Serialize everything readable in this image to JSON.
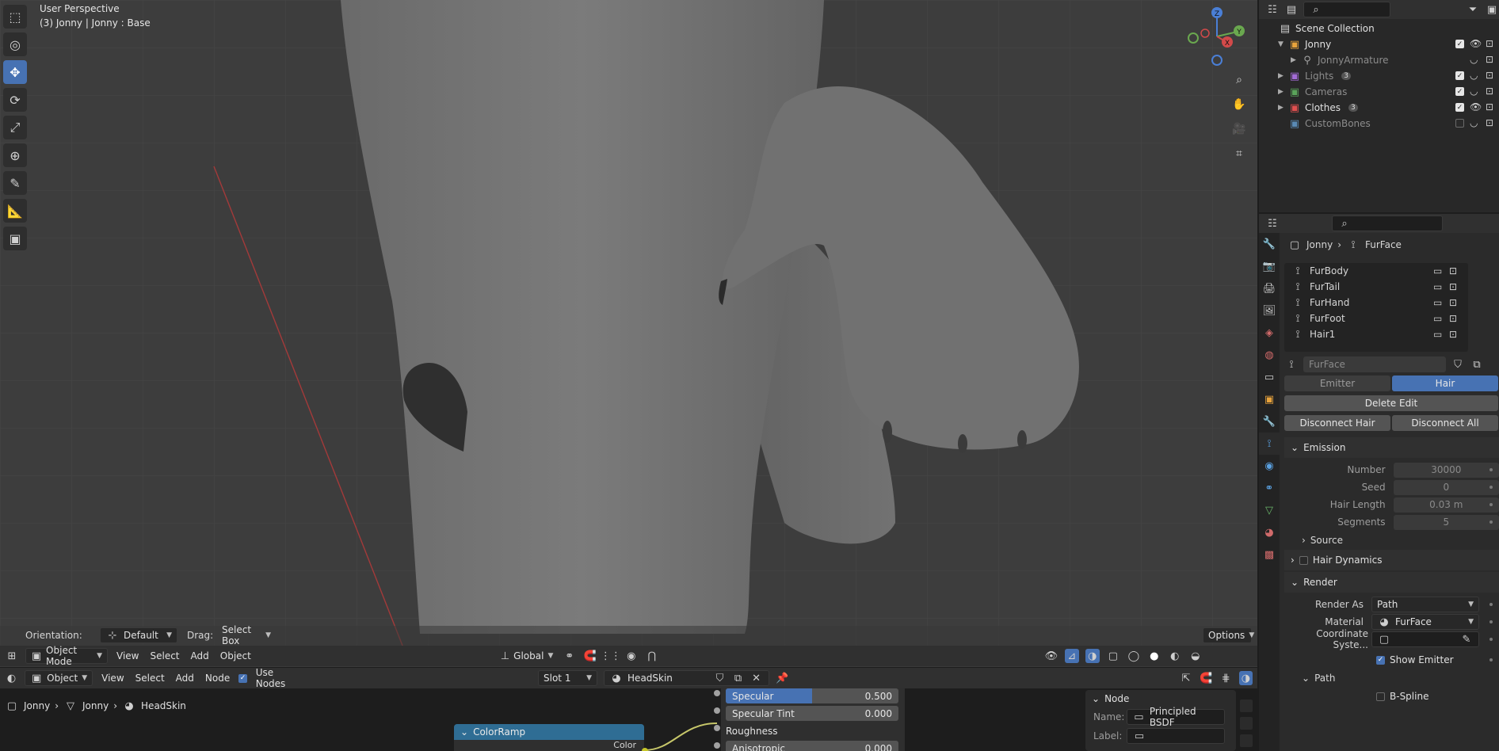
{
  "viewport": {
    "title": "User Perspective",
    "subtitle": "(3) Jonny | Jonny : Base",
    "orientation_label": "Orientation:",
    "orientation_value": "Default",
    "drag_label": "Drag:",
    "drag_value": "Select Box",
    "options_label": "Options",
    "gizmo": {
      "z": "Z",
      "y": "Y",
      "x": "X"
    },
    "header": {
      "mode": "Object Mode",
      "menus": [
        "View",
        "Select",
        "Add",
        "Object"
      ],
      "transform": "Global"
    }
  },
  "node_editor": {
    "header": {
      "type": "Object",
      "menus": [
        "View",
        "Select",
        "Add",
        "Node"
      ],
      "use_nodes_label": "Use Nodes",
      "slot": "Slot 1",
      "material": "HeadSkin"
    },
    "breadcrumb": [
      "Jonny",
      "Jonny",
      "HeadSkin"
    ],
    "colorramp_title": "ColorRamp",
    "colorramp_output": "Color",
    "bsdf_rows": [
      {
        "label": "Specular",
        "value": "0.500",
        "fill": 0.5
      },
      {
        "label": "Specular Tint",
        "value": "0.000",
        "fill": 0
      },
      {
        "label": "Roughness",
        "value": "",
        "fill": 0
      },
      {
        "label": "Anisotropic",
        "value": "0.000",
        "fill": 0
      }
    ],
    "sidebar": {
      "section": "Node",
      "name_label": "Name:",
      "name_value": "Principled BSDF",
      "label_label": "Label:",
      "label_value": ""
    }
  },
  "outliner": {
    "root": "Scene Collection",
    "items": [
      {
        "name": "Jonny",
        "color": "#e8a33c",
        "indent": 1,
        "expanded": true,
        "checked": true,
        "dim": false
      },
      {
        "name": "JonnyArmature",
        "color": "#a0a0a0",
        "indent": 2,
        "expanded": false,
        "checked": null,
        "dim": true
      },
      {
        "name": "Lights",
        "color": "#a36bd6",
        "indent": 1,
        "expanded": false,
        "checked": true,
        "dim": true,
        "badge": "3"
      },
      {
        "name": "Cameras",
        "color": "#5aa35a",
        "indent": 1,
        "expanded": false,
        "checked": true,
        "dim": true
      },
      {
        "name": "Clothes",
        "color": "#e05050",
        "indent": 1,
        "expanded": false,
        "checked": true,
        "dim": false,
        "badge": "3"
      },
      {
        "name": "CustomBones",
        "color": "#5a8ab5",
        "indent": 1,
        "expanded": null,
        "checked": false,
        "dim": true
      }
    ]
  },
  "properties": {
    "breadcrumb": [
      "Jonny",
      "FurFace"
    ],
    "particle_systems": [
      "FurBody",
      "FurTail",
      "FurHand",
      "FurFoot",
      "Hair1"
    ],
    "active_system": "FurFace",
    "type_tabs": [
      "Emitter",
      "Hair"
    ],
    "active_type": "Hair",
    "delete_edit": "Delete Edit",
    "disconnect_hair": "Disconnect Hair",
    "disconnect_all": "Disconnect All",
    "emission": {
      "title": "Emission",
      "fields": [
        {
          "label": "Number",
          "value": "30000"
        },
        {
          "label": "Seed",
          "value": "0"
        },
        {
          "label": "Hair Length",
          "value": "0.03 m"
        },
        {
          "label": "Segments",
          "value": "5"
        }
      ]
    },
    "source_label": "Source",
    "hair_dynamics_label": "Hair Dynamics",
    "render": {
      "title": "Render",
      "render_as_label": "Render As",
      "render_as_value": "Path",
      "material_label": "Material",
      "material_value": "FurFace",
      "coord_label": "Coordinate Syste...",
      "show_emitter_label": "Show Emitter",
      "path_label": "Path",
      "bspline_label": "B-Spline"
    }
  },
  "colors": {
    "accent": "#4772b3",
    "viewport_bg": "#3d3d3d",
    "panel_bg": "#2b2b2b"
  }
}
